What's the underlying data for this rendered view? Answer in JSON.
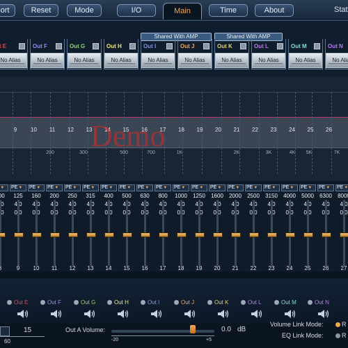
{
  "topbar": {
    "buttons": [
      "ort",
      "Reset",
      "Mode"
    ],
    "tabs": [
      "I/O",
      "Main",
      "Time",
      "About"
    ],
    "active_tab": "Main",
    "status_text": "Statu"
  },
  "channels": {
    "groups": [
      "Shared With AMP",
      "Shared With AMP"
    ],
    "items": [
      {
        "label": "ut E",
        "color": "#e04b55"
      },
      {
        "label": "Out F",
        "color": "#9a8cf0"
      },
      {
        "label": "Out G",
        "color": "#8fd46a"
      },
      {
        "label": "Out H",
        "color": "#f2e87a"
      },
      {
        "label": "Out I",
        "color": "#8095e8"
      },
      {
        "label": "Out J",
        "color": "#f0a55c"
      },
      {
        "label": "Out K",
        "color": "#e4d268"
      },
      {
        "label": "Out L",
        "color": "#b77be8"
      },
      {
        "label": "Out M",
        "color": "#7ee1c6"
      },
      {
        "label": "Out N",
        "color": "#b97bf0"
      }
    ],
    "alias": "No Alias"
  },
  "graph": {
    "band_numbers": [
      "9",
      "10",
      "11",
      "12",
      "13",
      "14",
      "15",
      "16",
      "17",
      "18",
      "19",
      "20",
      "21",
      "22",
      "23",
      "24",
      "25",
      "26"
    ],
    "freq_labels": [
      "200",
      "300",
      "500",
      "700",
      "1K",
      "2K",
      "3K",
      "4K",
      "5K",
      "7K"
    ],
    "watermark": "Demo"
  },
  "bands": {
    "filter": "PE",
    "freqs": [
      "100",
      "125",
      "160",
      "200",
      "250",
      "315",
      "400",
      "500",
      "630",
      "800",
      "1000",
      "1250",
      "1600",
      "2000",
      "2500",
      "3150",
      "4000",
      "5000",
      "6300",
      "8000"
    ],
    "q": [
      "4.0",
      "4.0",
      "4.0",
      "4.0",
      "4.0",
      "4.0",
      "4.0",
      "4.0",
      "4.0",
      "4.0",
      "4.0",
      "4.0",
      "4.0",
      "4.0",
      "4.0",
      "4.0",
      "4.0",
      "4.0",
      "4.0",
      "4.0"
    ],
    "gain": [
      "0.0",
      "0.0",
      "0.0",
      "0.0",
      "0.0",
      "0.0",
      "0.0",
      "0.0",
      "0.0",
      "0.0",
      "0.0",
      "0.0",
      "0.0",
      "0.0",
      "0.0",
      "0.0",
      "0.0",
      "0.0",
      "0.0",
      "0.0"
    ],
    "indices": [
      "8",
      "9",
      "10",
      "11",
      "12",
      "13",
      "14",
      "15",
      "16",
      "17",
      "18",
      "19",
      "20",
      "21",
      "22",
      "23",
      "24",
      "25",
      "26",
      "27"
    ]
  },
  "outputs": {
    "items": [
      {
        "label": "Out E",
        "color": "#e04b55"
      },
      {
        "label": "Out F",
        "color": "#9a8cf0"
      },
      {
        "label": "Out G",
        "color": "#8fd46a"
      },
      {
        "label": "Out H",
        "color": "#f2e87a"
      },
      {
        "label": "Out I",
        "color": "#8095e8"
      },
      {
        "label": "Out J",
        "color": "#f0a55c"
      },
      {
        "label": "Out K",
        "color": "#e4d268"
      },
      {
        "label": "Out L",
        "color": "#b77be8"
      },
      {
        "label": "Out M",
        "color": "#7ee1c6"
      },
      {
        "label": "Out N",
        "color": "#b97bf0"
      }
    ]
  },
  "bottom": {
    "left_value": "15",
    "left_scale": "60",
    "volume_label": "Out A Volume:",
    "volume_value": "0.0",
    "volume_unit": "dB",
    "scale_min": "-20",
    "scale_max": "+5",
    "volume_link_label": "Volume Link Mode:",
    "volume_link_value": "R",
    "eq_link_label": "EQ Link Mode:",
    "eq_link_value": "R"
  }
}
